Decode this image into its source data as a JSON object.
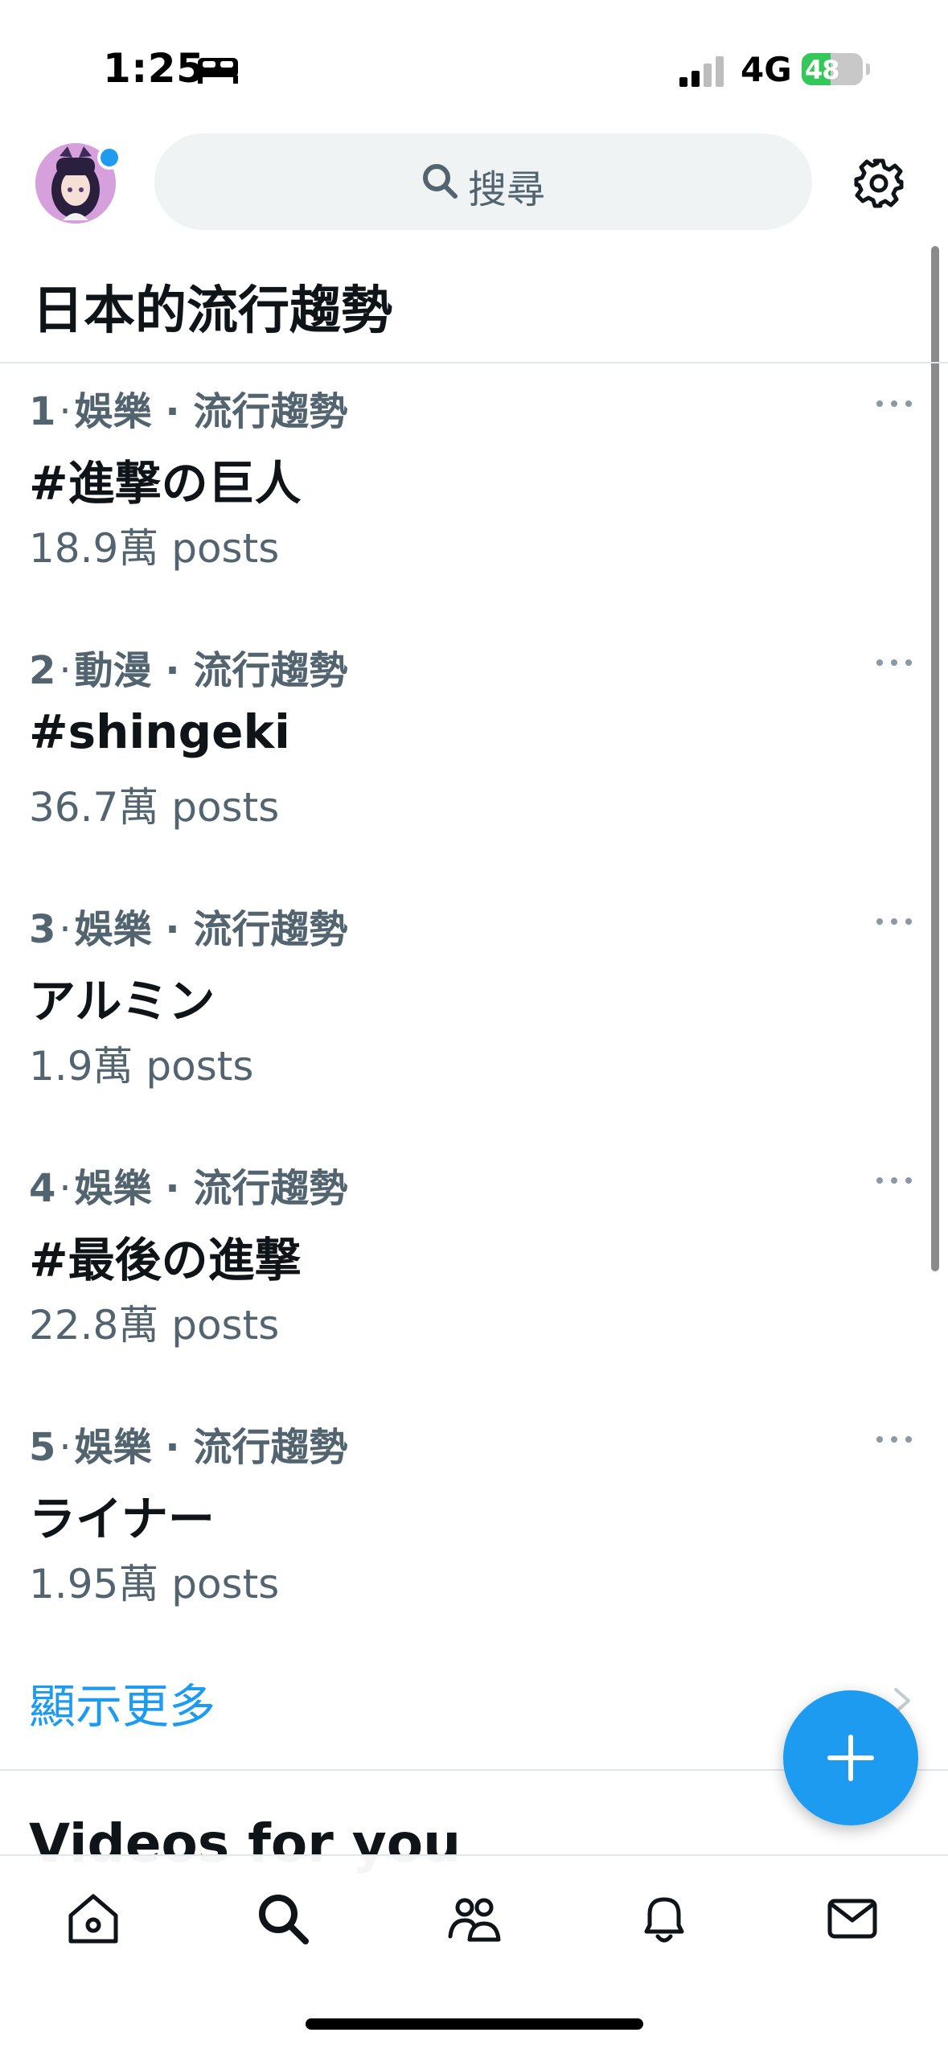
{
  "status_bar": {
    "time": "1:25",
    "network": "4G",
    "battery": "48",
    "battery_level": 0.48
  },
  "search": {
    "placeholder": "搜尋"
  },
  "section": {
    "title": "日本的流行趨勢"
  },
  "trends": [
    {
      "rank": "1",
      "category": "娛樂 · 流行趨勢",
      "name": "#進撃の巨人",
      "count": "18.9萬 posts"
    },
    {
      "rank": "2",
      "category": "動漫 · 流行趨勢",
      "name": "#shingeki",
      "count": "36.7萬 posts"
    },
    {
      "rank": "3",
      "category": "娛樂 · 流行趨勢",
      "name": "アルミン",
      "count": "1.9萬 posts"
    },
    {
      "rank": "4",
      "category": "娛樂 · 流行趨勢",
      "name": "#最後の進撃",
      "count": "22.8萬 posts"
    },
    {
      "rank": "5",
      "category": "娛樂 · 流行趨勢",
      "name": "ライナー",
      "count": "1.95萬 posts"
    }
  ],
  "show_more": "顯示更多",
  "videos_heading": "Videos for you",
  "icons": {
    "status": [
      "bed-icon",
      "signal-icon",
      "battery-icon"
    ],
    "header": [
      "avatar",
      "search-icon",
      "gear-icon"
    ],
    "nav": [
      "home-icon",
      "search-icon",
      "communities-icon",
      "bell-icon",
      "mail-icon"
    ],
    "fab": "plus-icon"
  },
  "colors": {
    "accent": "#1d9bf0",
    "text_primary": "#0f1419",
    "text_secondary": "#536471",
    "search_bg": "#eff3f4",
    "battery_green": "#34c759"
  }
}
